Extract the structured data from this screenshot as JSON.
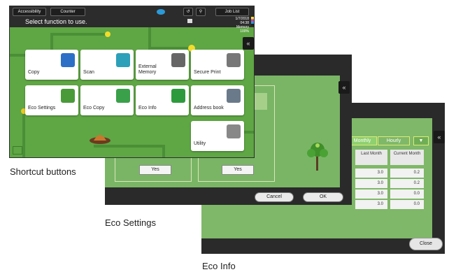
{
  "captions": {
    "shortcut": "Shortcut buttons",
    "eco_settings": "Eco Settings",
    "eco_info": "Eco Info"
  },
  "shortcut": {
    "topbar": {
      "accessibility": "Accessibility",
      "counter": "Counter",
      "job_list": "Job List"
    },
    "select_text": "Select function to use.",
    "clock_lines": [
      "1/7/2018",
      "04:38",
      "Memory",
      "100%"
    ],
    "tiles": [
      {
        "label": "Copy",
        "icon": "copy-icon",
        "color": "#2b6fc7"
      },
      {
        "label": "Scan",
        "icon": "scan-icon",
        "color": "#2ba0b8"
      },
      {
        "label": "External Memory",
        "icon": "usb-memory-icon",
        "color": "#666666"
      },
      {
        "label": "Secure Print",
        "icon": "secure-print-icon",
        "color": "#777777"
      },
      {
        "label": "Eco Settings",
        "icon": "eco-settings-icon",
        "color": "#4a9a3a"
      },
      {
        "label": "Eco Copy",
        "icon": "eco-copy-icon",
        "color": "#3aa04a"
      },
      {
        "label": "Eco Info",
        "icon": "eco-info-icon",
        "color": "#2e9a3e"
      },
      {
        "label": "Address book",
        "icon": "address-book-icon",
        "color": "#6a7a8a"
      },
      {
        "label": "Utility",
        "icon": "utility-gear-icon",
        "color": "#888888"
      }
    ]
  },
  "eco_settings": {
    "yes_left": "Yes",
    "yes_right": "Yes",
    "cancel": "Cancel",
    "ok": "OK"
  },
  "eco_info": {
    "tabs": {
      "monthly": "Monthly",
      "hourly": "Hourly"
    },
    "headers": {
      "last_month": "Last Month",
      "current_month": "Current Month"
    },
    "rows": [
      {
        "last": "3.0",
        "current": "0.2"
      },
      {
        "last": "3.0",
        "current": "0.2"
      },
      {
        "last": "3.0",
        "current": "0.0"
      },
      {
        "last": "3.0",
        "current": "0.0"
      }
    ],
    "close": "Close",
    "accent": "#8fd06f"
  }
}
